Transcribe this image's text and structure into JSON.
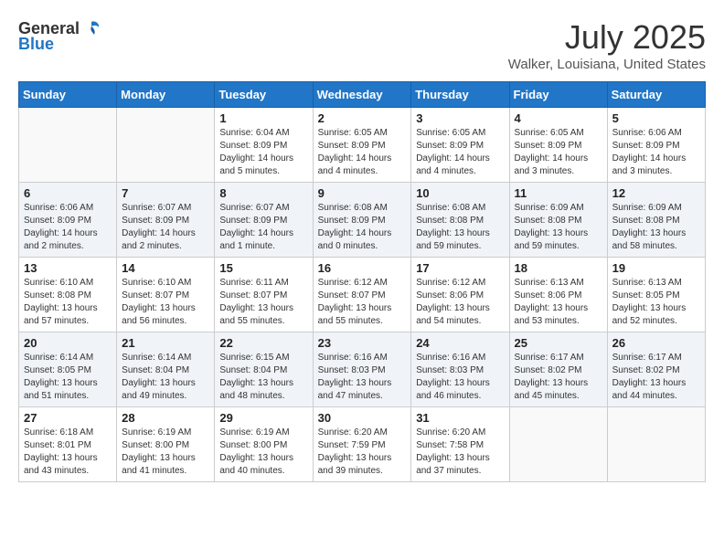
{
  "header": {
    "logo_general": "General",
    "logo_blue": "Blue",
    "month_title": "July 2025",
    "location": "Walker, Louisiana, United States"
  },
  "weekdays": [
    "Sunday",
    "Monday",
    "Tuesday",
    "Wednesday",
    "Thursday",
    "Friday",
    "Saturday"
  ],
  "weeks": [
    [
      {
        "day": "",
        "info": ""
      },
      {
        "day": "",
        "info": ""
      },
      {
        "day": "1",
        "info": "Sunrise: 6:04 AM\nSunset: 8:09 PM\nDaylight: 14 hours and 5 minutes."
      },
      {
        "day": "2",
        "info": "Sunrise: 6:05 AM\nSunset: 8:09 PM\nDaylight: 14 hours and 4 minutes."
      },
      {
        "day": "3",
        "info": "Sunrise: 6:05 AM\nSunset: 8:09 PM\nDaylight: 14 hours and 4 minutes."
      },
      {
        "day": "4",
        "info": "Sunrise: 6:05 AM\nSunset: 8:09 PM\nDaylight: 14 hours and 3 minutes."
      },
      {
        "day": "5",
        "info": "Sunrise: 6:06 AM\nSunset: 8:09 PM\nDaylight: 14 hours and 3 minutes."
      }
    ],
    [
      {
        "day": "6",
        "info": "Sunrise: 6:06 AM\nSunset: 8:09 PM\nDaylight: 14 hours and 2 minutes."
      },
      {
        "day": "7",
        "info": "Sunrise: 6:07 AM\nSunset: 8:09 PM\nDaylight: 14 hours and 2 minutes."
      },
      {
        "day": "8",
        "info": "Sunrise: 6:07 AM\nSunset: 8:09 PM\nDaylight: 14 hours and 1 minute."
      },
      {
        "day": "9",
        "info": "Sunrise: 6:08 AM\nSunset: 8:09 PM\nDaylight: 14 hours and 0 minutes."
      },
      {
        "day": "10",
        "info": "Sunrise: 6:08 AM\nSunset: 8:08 PM\nDaylight: 13 hours and 59 minutes."
      },
      {
        "day": "11",
        "info": "Sunrise: 6:09 AM\nSunset: 8:08 PM\nDaylight: 13 hours and 59 minutes."
      },
      {
        "day": "12",
        "info": "Sunrise: 6:09 AM\nSunset: 8:08 PM\nDaylight: 13 hours and 58 minutes."
      }
    ],
    [
      {
        "day": "13",
        "info": "Sunrise: 6:10 AM\nSunset: 8:08 PM\nDaylight: 13 hours and 57 minutes."
      },
      {
        "day": "14",
        "info": "Sunrise: 6:10 AM\nSunset: 8:07 PM\nDaylight: 13 hours and 56 minutes."
      },
      {
        "day": "15",
        "info": "Sunrise: 6:11 AM\nSunset: 8:07 PM\nDaylight: 13 hours and 55 minutes."
      },
      {
        "day": "16",
        "info": "Sunrise: 6:12 AM\nSunset: 8:07 PM\nDaylight: 13 hours and 55 minutes."
      },
      {
        "day": "17",
        "info": "Sunrise: 6:12 AM\nSunset: 8:06 PM\nDaylight: 13 hours and 54 minutes."
      },
      {
        "day": "18",
        "info": "Sunrise: 6:13 AM\nSunset: 8:06 PM\nDaylight: 13 hours and 53 minutes."
      },
      {
        "day": "19",
        "info": "Sunrise: 6:13 AM\nSunset: 8:05 PM\nDaylight: 13 hours and 52 minutes."
      }
    ],
    [
      {
        "day": "20",
        "info": "Sunrise: 6:14 AM\nSunset: 8:05 PM\nDaylight: 13 hours and 51 minutes."
      },
      {
        "day": "21",
        "info": "Sunrise: 6:14 AM\nSunset: 8:04 PM\nDaylight: 13 hours and 49 minutes."
      },
      {
        "day": "22",
        "info": "Sunrise: 6:15 AM\nSunset: 8:04 PM\nDaylight: 13 hours and 48 minutes."
      },
      {
        "day": "23",
        "info": "Sunrise: 6:16 AM\nSunset: 8:03 PM\nDaylight: 13 hours and 47 minutes."
      },
      {
        "day": "24",
        "info": "Sunrise: 6:16 AM\nSunset: 8:03 PM\nDaylight: 13 hours and 46 minutes."
      },
      {
        "day": "25",
        "info": "Sunrise: 6:17 AM\nSunset: 8:02 PM\nDaylight: 13 hours and 45 minutes."
      },
      {
        "day": "26",
        "info": "Sunrise: 6:17 AM\nSunset: 8:02 PM\nDaylight: 13 hours and 44 minutes."
      }
    ],
    [
      {
        "day": "27",
        "info": "Sunrise: 6:18 AM\nSunset: 8:01 PM\nDaylight: 13 hours and 43 minutes."
      },
      {
        "day": "28",
        "info": "Sunrise: 6:19 AM\nSunset: 8:00 PM\nDaylight: 13 hours and 41 minutes."
      },
      {
        "day": "29",
        "info": "Sunrise: 6:19 AM\nSunset: 8:00 PM\nDaylight: 13 hours and 40 minutes."
      },
      {
        "day": "30",
        "info": "Sunrise: 6:20 AM\nSunset: 7:59 PM\nDaylight: 13 hours and 39 minutes."
      },
      {
        "day": "31",
        "info": "Sunrise: 6:20 AM\nSunset: 7:58 PM\nDaylight: 13 hours and 37 minutes."
      },
      {
        "day": "",
        "info": ""
      },
      {
        "day": "",
        "info": ""
      }
    ]
  ]
}
